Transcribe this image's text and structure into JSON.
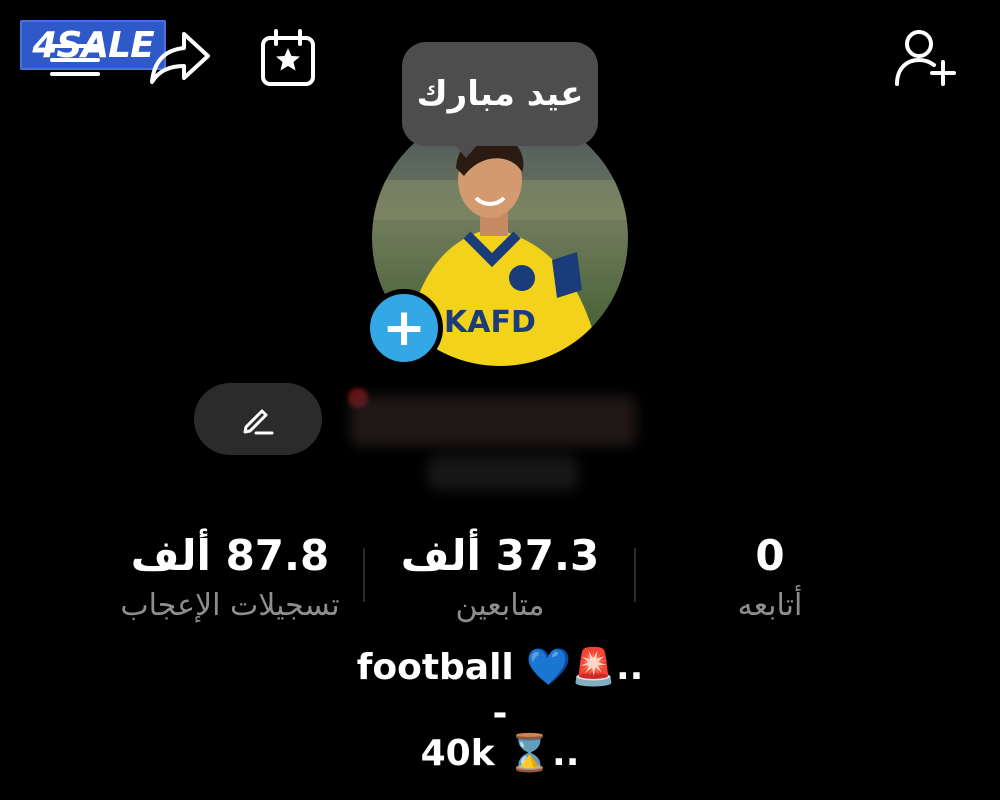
{
  "watermark": {
    "text": "4SALE",
    "color": "#2f59c9"
  },
  "toolbar": {
    "icons": [
      "menu-icon",
      "share-icon",
      "calendar-star-icon",
      "add-user-icon"
    ]
  },
  "tooltip": {
    "text": "عيد مبارك"
  },
  "profile": {
    "avatar": "profile-photo",
    "add_button_label": "+",
    "add_button_color": "#34a8e6",
    "edit_icon": "pencil-icon"
  },
  "stats": {
    "likes": {
      "value": "87.8 ألف",
      "label": "تسجيلات الإعجاب"
    },
    "followers": {
      "value": "37.3 ألف",
      "label": "متابعين"
    },
    "following": {
      "value": "0",
      "label": "أتابعه"
    }
  },
  "bio": {
    "line1": "football 💙🚨..",
    "line2": "-",
    "line3": "40k ⌛.."
  }
}
